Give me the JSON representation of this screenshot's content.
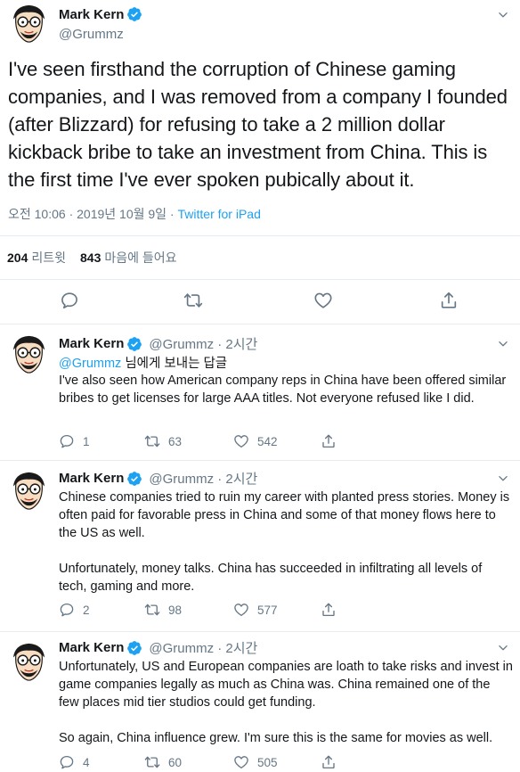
{
  "colors": {
    "accent": "#1da1f2",
    "secondary_text": "#657786",
    "primary_text": "#14171a",
    "border": "#e6ecf0"
  },
  "main_tweet": {
    "author_name": "Mark Kern",
    "handle": "@Grummz",
    "text": "I've seen firsthand the corruption of Chinese gaming companies, and I was removed  from a company I founded (after Blizzard) for refusing to take a 2 million dollar kickback bribe to take an investment from China. This is the first time I've ever spoken pubically about it.",
    "timestamp": "오전 10:06 · 2019년 10월 9일 · ",
    "source": "Twitter for iPad",
    "retweets_count": "204",
    "retweets_label": "리트윗",
    "likes_count": "843",
    "likes_label": "마음에 들어요"
  },
  "replies": [
    {
      "author_name": "Mark Kern",
      "handle_time": "@Grummz · 2시간",
      "reply_to_mention": "@Grummz",
      "reply_to_suffix": " 님에게 보내는 답글",
      "text": "I've also seen how American company reps in China have been offered similar bribes to get licenses for large AAA titles. Not everyone refused like I did.",
      "reply_count": "1",
      "retweet_count": "63",
      "like_count": "542"
    },
    {
      "author_name": "Mark Kern",
      "handle_time": "@Grummz · 2시간",
      "text": "Chinese companies tried to ruin my career with planted press stories. Money is often paid for favorable press in China and some of that money flows here to the US as well.\n\nUnfortunately, money talks. China has succeeded in infiltrating all levels of tech, gaming and more.",
      "reply_count": "2",
      "retweet_count": "98",
      "like_count": "577"
    },
    {
      "author_name": "Mark Kern",
      "handle_time": "@Grummz · 2시간",
      "text": "Unfortunately, US and European companies are loath to take risks and invest in game companies legally as much as China was. China remained one of the few places mid tier studios could get funding.\n\nSo again, China influence grew. I'm sure this is the same for movies as well.",
      "reply_count": "4",
      "retweet_count": "60",
      "like_count": "505"
    }
  ],
  "icons": [
    "reply-icon",
    "retweet-icon",
    "like-icon",
    "share-icon",
    "verified-badge-icon",
    "chevron-down-icon"
  ]
}
